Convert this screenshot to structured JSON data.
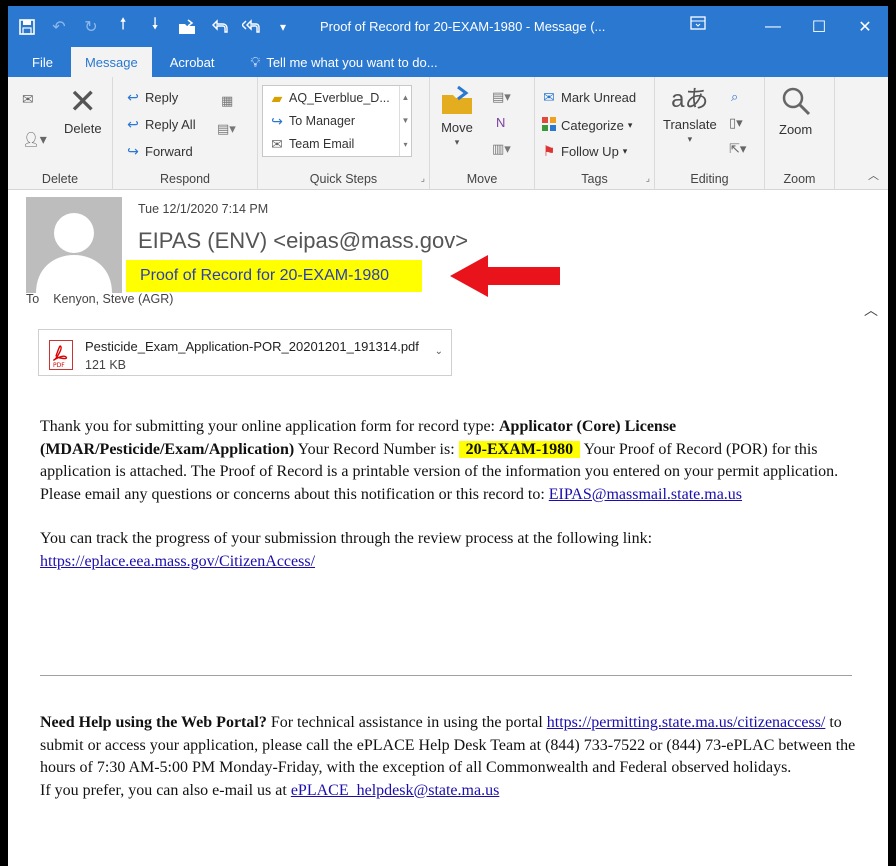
{
  "window": {
    "title": "Proof of Record for 20-EXAM-1980 - Message (..."
  },
  "tabs": {
    "file": "File",
    "message": "Message",
    "acrobat": "Acrobat",
    "tell_me": "Tell me what you want to do..."
  },
  "ribbon": {
    "delete_group": {
      "label": "Delete",
      "delete_btn": "Delete"
    },
    "respond_group": {
      "label": "Respond",
      "reply": "Reply",
      "reply_all": "Reply All",
      "forward": "Forward"
    },
    "quick_steps_group": {
      "label": "Quick Steps",
      "items": [
        "AQ_Everblue_D...",
        "To Manager",
        "Team Email"
      ]
    },
    "move_group": {
      "label": "Move",
      "move_btn": "Move"
    },
    "tags_group": {
      "label": "Tags",
      "mark_unread": "Mark Unread",
      "categorize": "Categorize",
      "follow_up": "Follow Up"
    },
    "editing_group": {
      "label": "Editing",
      "translate": "Translate"
    },
    "zoom_group": {
      "label": "Zoom",
      "zoom_btn": "Zoom"
    }
  },
  "message": {
    "date": "Tue 12/1/2020 7:14 PM",
    "sender": "EIPAS (ENV) <eipas@mass.gov>",
    "subject": "Proof of Record for 20-EXAM-1980",
    "to_label": "To",
    "to_value": "Kenyon, Steve (AGR)"
  },
  "attachment": {
    "name": "Pesticide_Exam_Application-POR_20201201_191314.pdf",
    "size": "121 KB",
    "icon_text": "PDF"
  },
  "body": {
    "p1_a": "Thank you for submitting your online application form for record type: ",
    "p1_bold": "Applicator (Core) License (MDAR/Pesticide/Exam/Application)",
    "p1_b": " Your Record Number is: ",
    "record_number": "20-EXAM-1980",
    "p1_c": " Your Proof of Record (POR) for this application is attached. The Proof of Record is a printable version of the information you entered on your permit application. Please email any questions or concerns about this notification or this record to: ",
    "email_link": "EIPAS@massmail.state.ma.us",
    "p2_a": "You can track the progress of your submission through the review process at the following link: ",
    "track_link": "https://eplace.eea.mass.gov/CitizenAccess/",
    "help_bold": "Need Help using the Web Portal?",
    "help_a": " For technical assistance in using the portal ",
    "help_link": "https://permitting.state.ma.us/citizenaccess/",
    "help_b": " to submit or access your application, please call the ePLACE Help Desk Team at (844) 733-7522 or (844) 73-ePLAC between the hours of 7:30 AM-5:00 PM Monday-Friday, with the exception of all Commonwealth and Federal observed holidays.",
    "help_c": "If you prefer, you can also e-mail us at ",
    "help_email": "ePLACE_helpdesk@state.ma.us"
  },
  "colors": {
    "accent": "#2b78d0",
    "highlight": "#ffff00",
    "annotation_arrow": "#e8131b"
  }
}
